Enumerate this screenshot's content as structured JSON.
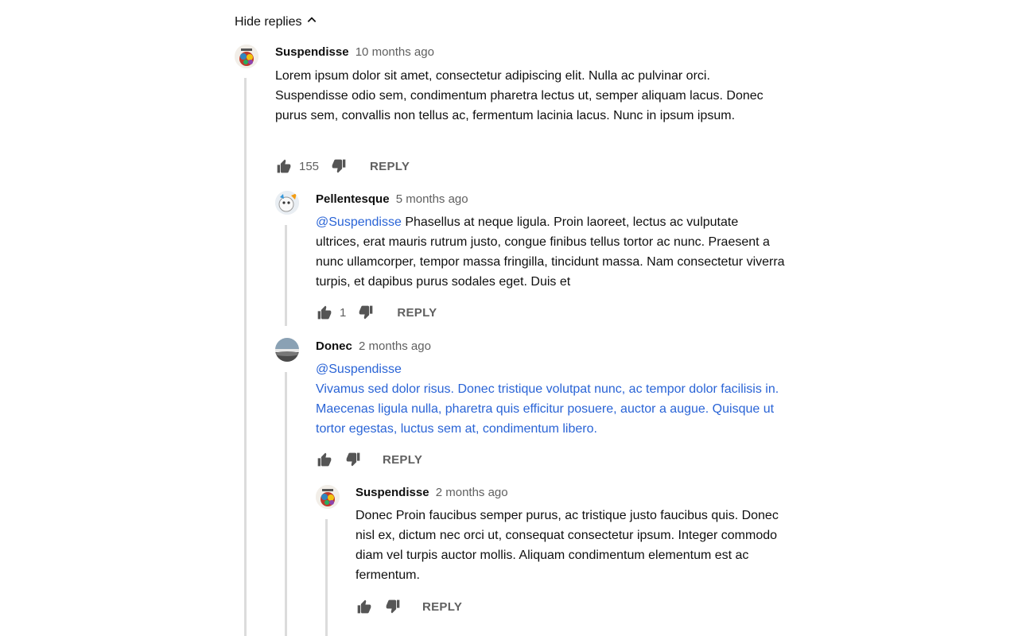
{
  "toggle": {
    "label": "Hide replies"
  },
  "comments": [
    {
      "author": "Suspendisse",
      "time": "10 months ago",
      "mention": "",
      "text": "Lorem ipsum dolor sit amet, consectetur adipiscing elit. Nulla ac pulvinar orci. Suspendisse odio sem, condimentum pharetra lectus ut, semper aliquam lacus. Donec purus sem, convallis non tellus ac, fermentum lacinia lacus. Nunc in ipsum ipsum.",
      "likes": "155",
      "reply_label": "REPLY",
      "avatar_icon": "festival-avatar-icon"
    },
    {
      "author": "Pellentesque",
      "time": "5 months ago",
      "mention": "@Suspendisse",
      "text": "Phasellus at neque ligula. Proin laoreet, lectus ac vulputate ultrices, erat mauris rutrum justo, congue finibus tellus tortor ac nunc. Praesent a nunc ullamcorper, tempor massa fringilla, tincidunt massa. Nam consectetur viverra turpis, et dapibus purus sodales eget. Duis et",
      "likes": "1",
      "reply_label": "REPLY",
      "avatar_icon": "cartoon-avatar-icon"
    },
    {
      "author": "Donec",
      "time": "2 months ago",
      "mention": "@Suspendisse",
      "text": "Vivamus sed dolor risus. Donec tristique volutpat nunc, ac tempor dolor facilisis in. Maecenas ligula nulla, pharetra quis efficitur posuere, auctor a augue. Quisque ut tortor egestas, luctus sem at, condimentum libero.",
      "likes": "",
      "reply_label": "REPLY",
      "avatar_icon": "landscape-avatar-icon"
    },
    {
      "author": "Suspendisse",
      "time": "2 months ago",
      "mention": "",
      "text": "Donec Proin faucibus semper purus, ac tristique justo faucibus quis. Donec nisl ex, dictum nec orci ut, consequat consectetur ipsum. Integer commodo diam vel turpis auctor mollis. Aliquam condimentum elementum est ac fermentum.",
      "likes": "",
      "reply_label": "REPLY",
      "avatar_icon": "festival-avatar-icon"
    }
  ],
  "colors": {
    "link": "#2a64d6",
    "thread_line": "#dcdcdc",
    "muted": "#606060"
  }
}
